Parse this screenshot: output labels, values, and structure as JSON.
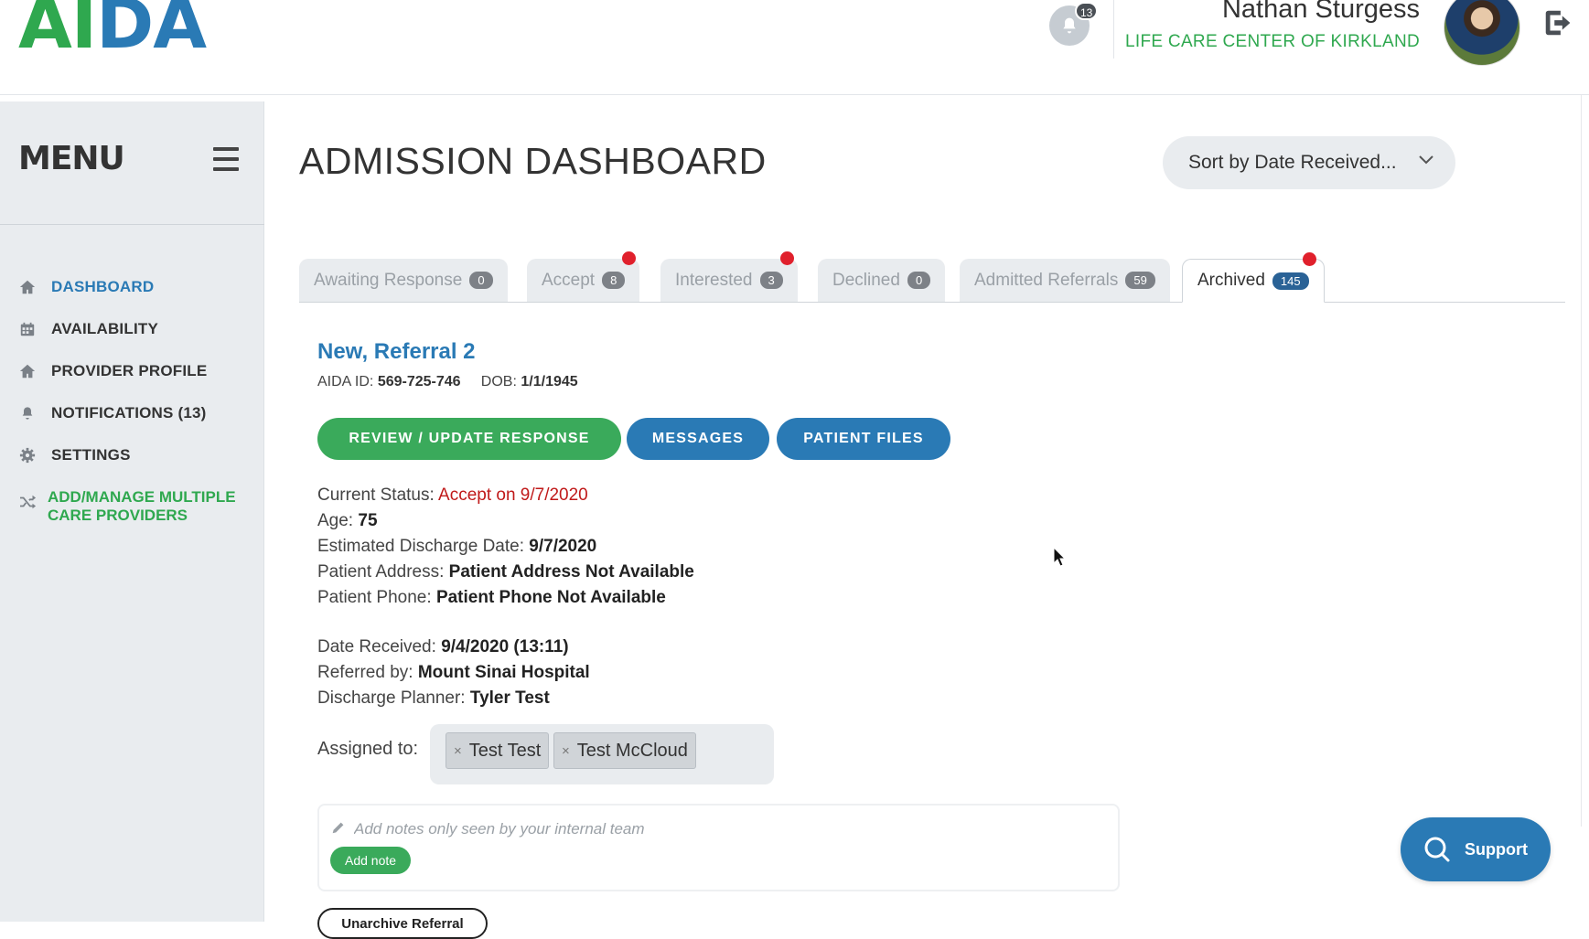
{
  "header": {
    "logo_part1": "AI",
    "logo_part2": "DA",
    "notification_count": "13",
    "user_name": "Nathan Sturgess",
    "user_org": "LIFE CARE CENTER OF KIRKLAND"
  },
  "sidebar": {
    "menu_title": "MENU",
    "items": [
      {
        "label": "DASHBOARD",
        "icon": "home-icon",
        "active": true
      },
      {
        "label": "AVAILABILITY",
        "icon": "calendar-icon"
      },
      {
        "label": "PROVIDER PROFILE",
        "icon": "home-icon"
      },
      {
        "label": "NOTIFICATIONS (13)",
        "icon": "bell-icon"
      },
      {
        "label": "SETTINGS",
        "icon": "gear-icon"
      }
    ],
    "multi_provider_label": "ADD/MANAGE MULTIPLE CARE PROVIDERS"
  },
  "main": {
    "title": "ADMISSION DASHBOARD",
    "sort_label": "Sort by Date Received...",
    "tabs": [
      {
        "label": "Awaiting Response",
        "count": "0",
        "dot": false
      },
      {
        "label": "Accept",
        "count": "8",
        "dot": true
      },
      {
        "label": "Interested",
        "count": "3",
        "dot": true
      },
      {
        "label": "Declined",
        "count": "0",
        "dot": false
      },
      {
        "label": "Admitted Referrals",
        "count": "59",
        "dot": false
      },
      {
        "label": "Archived",
        "count": "145",
        "dot": true,
        "active": true
      }
    ],
    "referral": {
      "name": "New, Referral 2",
      "aida_id_label": "AIDA ID:",
      "aida_id": "569-725-746",
      "dob_label": "DOB:",
      "dob": "1/1/1945",
      "buttons": {
        "review": "REVIEW / UPDATE RESPONSE",
        "messages": "MESSAGES",
        "patient_files": "PATIENT FILES"
      },
      "current_status_label": "Current Status:",
      "current_status": "Accept on 9/7/2020",
      "age_label": "Age:",
      "age": "75",
      "discharge_label": "Estimated Discharge Date:",
      "discharge_date": "9/7/2020",
      "address_label": "Patient Address:",
      "address": "Patient Address Not Available",
      "phone_label": "Patient Phone:",
      "phone": "Patient Phone Not Available",
      "received_label": "Date Received:",
      "received": "9/4/2020 (13:11)",
      "referred_label": "Referred by:",
      "referred_by": "Mount Sinai Hospital",
      "planner_label": "Discharge Planner:",
      "planner": "Tyler Test",
      "assigned_label": "Assigned to:",
      "assigned": [
        "Test Test",
        "Test McCloud"
      ],
      "notes_placeholder": "Add notes only seen by your internal team",
      "add_note_label": "Add note",
      "unarchive_label": "Unarchive Referral"
    },
    "support_label": "Support"
  },
  "colors": {
    "brand_green": "#2fa84f",
    "brand_blue": "#2a7ab5",
    "status_red": "#c01a1a",
    "badge_dot": "#e0202c"
  }
}
